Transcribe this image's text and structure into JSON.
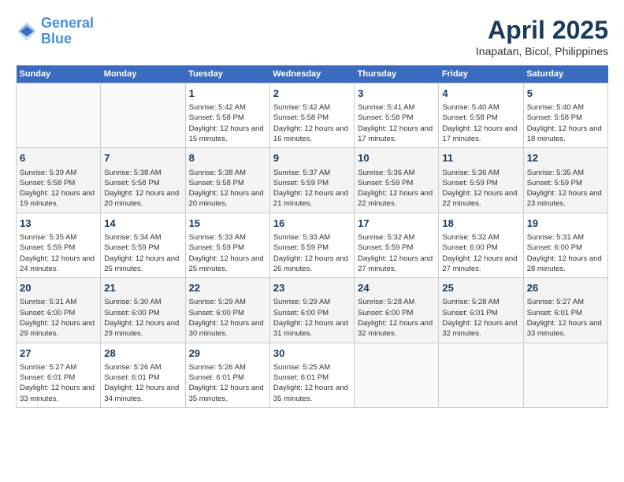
{
  "header": {
    "logo_line1": "General",
    "logo_line2": "Blue",
    "month_title": "April 2025",
    "location": "Inapatan, Bicol, Philippines"
  },
  "days_of_week": [
    "Sunday",
    "Monday",
    "Tuesday",
    "Wednesday",
    "Thursday",
    "Friday",
    "Saturday"
  ],
  "weeks": [
    [
      {
        "day": "",
        "sunrise": "",
        "sunset": "",
        "daylight": ""
      },
      {
        "day": "",
        "sunrise": "",
        "sunset": "",
        "daylight": ""
      },
      {
        "day": "1",
        "sunrise": "Sunrise: 5:42 AM",
        "sunset": "Sunset: 5:58 PM",
        "daylight": "Daylight: 12 hours and 15 minutes."
      },
      {
        "day": "2",
        "sunrise": "Sunrise: 5:42 AM",
        "sunset": "Sunset: 5:58 PM",
        "daylight": "Daylight: 12 hours and 16 minutes."
      },
      {
        "day": "3",
        "sunrise": "Sunrise: 5:41 AM",
        "sunset": "Sunset: 5:58 PM",
        "daylight": "Daylight: 12 hours and 17 minutes."
      },
      {
        "day": "4",
        "sunrise": "Sunrise: 5:40 AM",
        "sunset": "Sunset: 5:58 PM",
        "daylight": "Daylight: 12 hours and 17 minutes."
      },
      {
        "day": "5",
        "sunrise": "Sunrise: 5:40 AM",
        "sunset": "Sunset: 5:58 PM",
        "daylight": "Daylight: 12 hours and 18 minutes."
      }
    ],
    [
      {
        "day": "6",
        "sunrise": "Sunrise: 5:39 AM",
        "sunset": "Sunset: 5:58 PM",
        "daylight": "Daylight: 12 hours and 19 minutes."
      },
      {
        "day": "7",
        "sunrise": "Sunrise: 5:38 AM",
        "sunset": "Sunset: 5:58 PM",
        "daylight": "Daylight: 12 hours and 20 minutes."
      },
      {
        "day": "8",
        "sunrise": "Sunrise: 5:38 AM",
        "sunset": "Sunset: 5:58 PM",
        "daylight": "Daylight: 12 hours and 20 minutes."
      },
      {
        "day": "9",
        "sunrise": "Sunrise: 5:37 AM",
        "sunset": "Sunset: 5:59 PM",
        "daylight": "Daylight: 12 hours and 21 minutes."
      },
      {
        "day": "10",
        "sunrise": "Sunrise: 5:36 AM",
        "sunset": "Sunset: 5:59 PM",
        "daylight": "Daylight: 12 hours and 22 minutes."
      },
      {
        "day": "11",
        "sunrise": "Sunrise: 5:36 AM",
        "sunset": "Sunset: 5:59 PM",
        "daylight": "Daylight: 12 hours and 22 minutes."
      },
      {
        "day": "12",
        "sunrise": "Sunrise: 5:35 AM",
        "sunset": "Sunset: 5:59 PM",
        "daylight": "Daylight: 12 hours and 23 minutes."
      }
    ],
    [
      {
        "day": "13",
        "sunrise": "Sunrise: 5:35 AM",
        "sunset": "Sunset: 5:59 PM",
        "daylight": "Daylight: 12 hours and 24 minutes."
      },
      {
        "day": "14",
        "sunrise": "Sunrise: 5:34 AM",
        "sunset": "Sunset: 5:59 PM",
        "daylight": "Daylight: 12 hours and 25 minutes."
      },
      {
        "day": "15",
        "sunrise": "Sunrise: 5:33 AM",
        "sunset": "Sunset: 5:59 PM",
        "daylight": "Daylight: 12 hours and 25 minutes."
      },
      {
        "day": "16",
        "sunrise": "Sunrise: 5:33 AM",
        "sunset": "Sunset: 5:59 PM",
        "daylight": "Daylight: 12 hours and 26 minutes."
      },
      {
        "day": "17",
        "sunrise": "Sunrise: 5:32 AM",
        "sunset": "Sunset: 5:59 PM",
        "daylight": "Daylight: 12 hours and 27 minutes."
      },
      {
        "day": "18",
        "sunrise": "Sunrise: 5:32 AM",
        "sunset": "Sunset: 6:00 PM",
        "daylight": "Daylight: 12 hours and 27 minutes."
      },
      {
        "day": "19",
        "sunrise": "Sunrise: 5:31 AM",
        "sunset": "Sunset: 6:00 PM",
        "daylight": "Daylight: 12 hours and 28 minutes."
      }
    ],
    [
      {
        "day": "20",
        "sunrise": "Sunrise: 5:31 AM",
        "sunset": "Sunset: 6:00 PM",
        "daylight": "Daylight: 12 hours and 29 minutes."
      },
      {
        "day": "21",
        "sunrise": "Sunrise: 5:30 AM",
        "sunset": "Sunset: 6:00 PM",
        "daylight": "Daylight: 12 hours and 29 minutes."
      },
      {
        "day": "22",
        "sunrise": "Sunrise: 5:29 AM",
        "sunset": "Sunset: 6:00 PM",
        "daylight": "Daylight: 12 hours and 30 minutes."
      },
      {
        "day": "23",
        "sunrise": "Sunrise: 5:29 AM",
        "sunset": "Sunset: 6:00 PM",
        "daylight": "Daylight: 12 hours and 31 minutes."
      },
      {
        "day": "24",
        "sunrise": "Sunrise: 5:28 AM",
        "sunset": "Sunset: 6:00 PM",
        "daylight": "Daylight: 12 hours and 32 minutes."
      },
      {
        "day": "25",
        "sunrise": "Sunrise: 5:28 AM",
        "sunset": "Sunset: 6:01 PM",
        "daylight": "Daylight: 12 hours and 32 minutes."
      },
      {
        "day": "26",
        "sunrise": "Sunrise: 5:27 AM",
        "sunset": "Sunset: 6:01 PM",
        "daylight": "Daylight: 12 hours and 33 minutes."
      }
    ],
    [
      {
        "day": "27",
        "sunrise": "Sunrise: 5:27 AM",
        "sunset": "Sunset: 6:01 PM",
        "daylight": "Daylight: 12 hours and 33 minutes."
      },
      {
        "day": "28",
        "sunrise": "Sunrise: 5:26 AM",
        "sunset": "Sunset: 6:01 PM",
        "daylight": "Daylight: 12 hours and 34 minutes."
      },
      {
        "day": "29",
        "sunrise": "Sunrise: 5:26 AM",
        "sunset": "Sunset: 6:01 PM",
        "daylight": "Daylight: 12 hours and 35 minutes."
      },
      {
        "day": "30",
        "sunrise": "Sunrise: 5:25 AM",
        "sunset": "Sunset: 6:01 PM",
        "daylight": "Daylight: 12 hours and 35 minutes."
      },
      {
        "day": "",
        "sunrise": "",
        "sunset": "",
        "daylight": ""
      },
      {
        "day": "",
        "sunrise": "",
        "sunset": "",
        "daylight": ""
      },
      {
        "day": "",
        "sunrise": "",
        "sunset": "",
        "daylight": ""
      }
    ]
  ]
}
